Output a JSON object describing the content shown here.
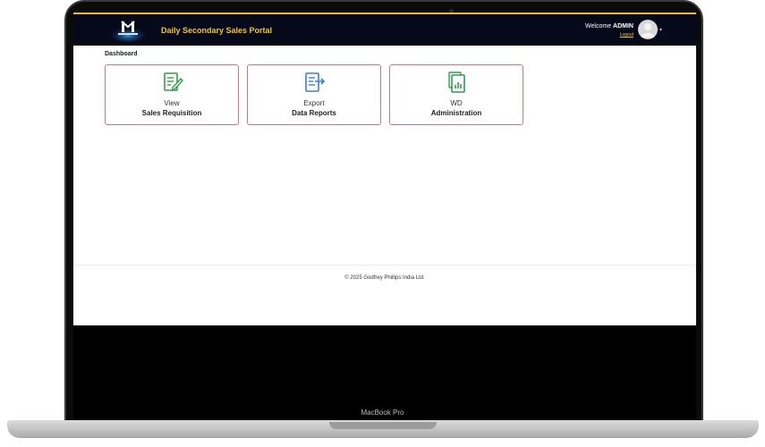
{
  "header": {
    "title": "Daily Secondary Sales Portal",
    "welcome_prefix": "Welcome",
    "username": "ADMIN",
    "logout": "Logout"
  },
  "breadcrumb": "Dashboard",
  "tiles": [
    {
      "line1": "View",
      "line2": "Sales Requisition",
      "icon": "edit-document-icon"
    },
    {
      "line1": "Export",
      "line2": "Data Reports",
      "icon": "export-document-icon"
    },
    {
      "line1": "WD",
      "line2": "Administration",
      "icon": "report-document-icon"
    }
  ],
  "footer": {
    "copyright": "© 2025 Godfrey Phillips India Ltd."
  },
  "device": {
    "label": "MacBook Pro"
  }
}
